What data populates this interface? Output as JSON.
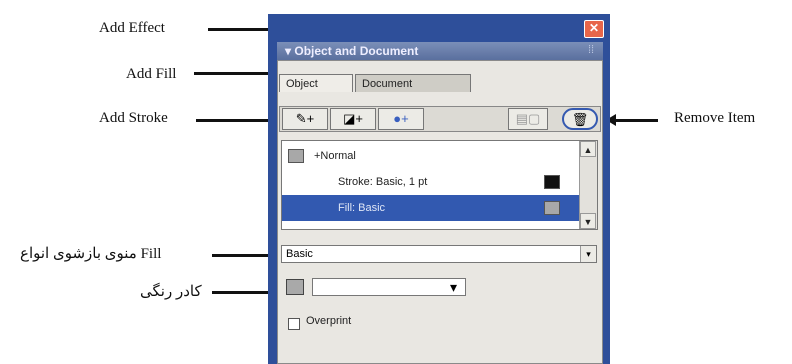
{
  "annotations": {
    "add_effect": "Add Effect",
    "add_fill": "Add Fill",
    "add_stroke": "Add Stroke",
    "remove_item": "Remove Item",
    "fill_menu": "منوی بازشوی انواع Fill",
    "color_box": "کادر رنگی"
  },
  "panel": {
    "title": "▾ Object and Document",
    "close_glyph": "✕",
    "grip": "⁞⁞",
    "tabs": [
      "Object",
      "Document"
    ]
  },
  "toolbar": {
    "stroke_btn": "✎+",
    "fill_btn": "◪+",
    "effect_btn": "●+",
    "mid_btn": "▤▢",
    "remove_btn": "🗑"
  },
  "list": {
    "rows": [
      {
        "label": "+Normal"
      },
      {
        "label": "Stroke: Basic, 1 pt"
      },
      {
        "label": "Fill: Basic"
      }
    ],
    "scroll_up": "▲",
    "scroll_down": "▼"
  },
  "fill_select": {
    "value": "Basic",
    "arrow": "▾"
  },
  "color_dropdown_arrow": "▾",
  "overprint_label": "Overprint"
}
